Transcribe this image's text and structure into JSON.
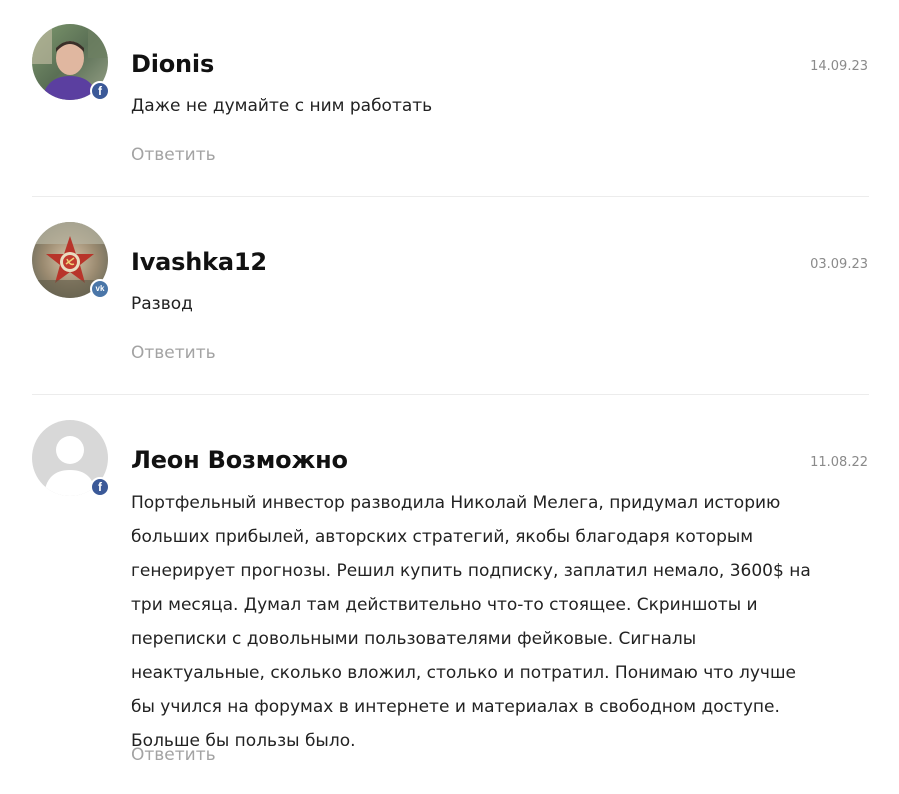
{
  "comments": [
    {
      "author": "Dionis",
      "date": "14.09.23",
      "text": "Даже не думайте с ним работать",
      "reply_label": "Ответить",
      "avatar": "user-photo",
      "social": "facebook",
      "social_glyph": "f"
    },
    {
      "author": "Ivashka12",
      "date": "03.09.23",
      "text": "Развод",
      "reply_label": "Ответить",
      "avatar": "order-star-image",
      "social": "vk",
      "social_glyph": "vk"
    },
    {
      "author": "Леон Возможно",
      "date": "11.08.22",
      "text": "Портфельный инвестор разводила Николай Мелега, придумал историю больших прибылей, авторских стратегий, якобы благодаря которым генерирует прогнозы. Решил купить подписку, заплатил немало, 3600$ на три месяца. Думал там действительно что-то стоящее. Скриншоты и переписки с довольными пользователями фейковые. Сигналы неактуальные, сколько вложил, столько и потратил. Понимаю что лучше бы учился на форумах в интернете и материалах в свободном доступе. Больше бы пользы было.",
      "reply_label": "Ответить",
      "avatar": "default-user-silhouette",
      "social": "facebook",
      "social_glyph": "f"
    }
  ],
  "colors": {
    "author": "#111111",
    "text": "#222222",
    "date": "#8a8a8a",
    "reply": "#a3a3a3",
    "divider": "#ececec",
    "facebook": "#3b5998",
    "vk": "#4a76a8"
  }
}
